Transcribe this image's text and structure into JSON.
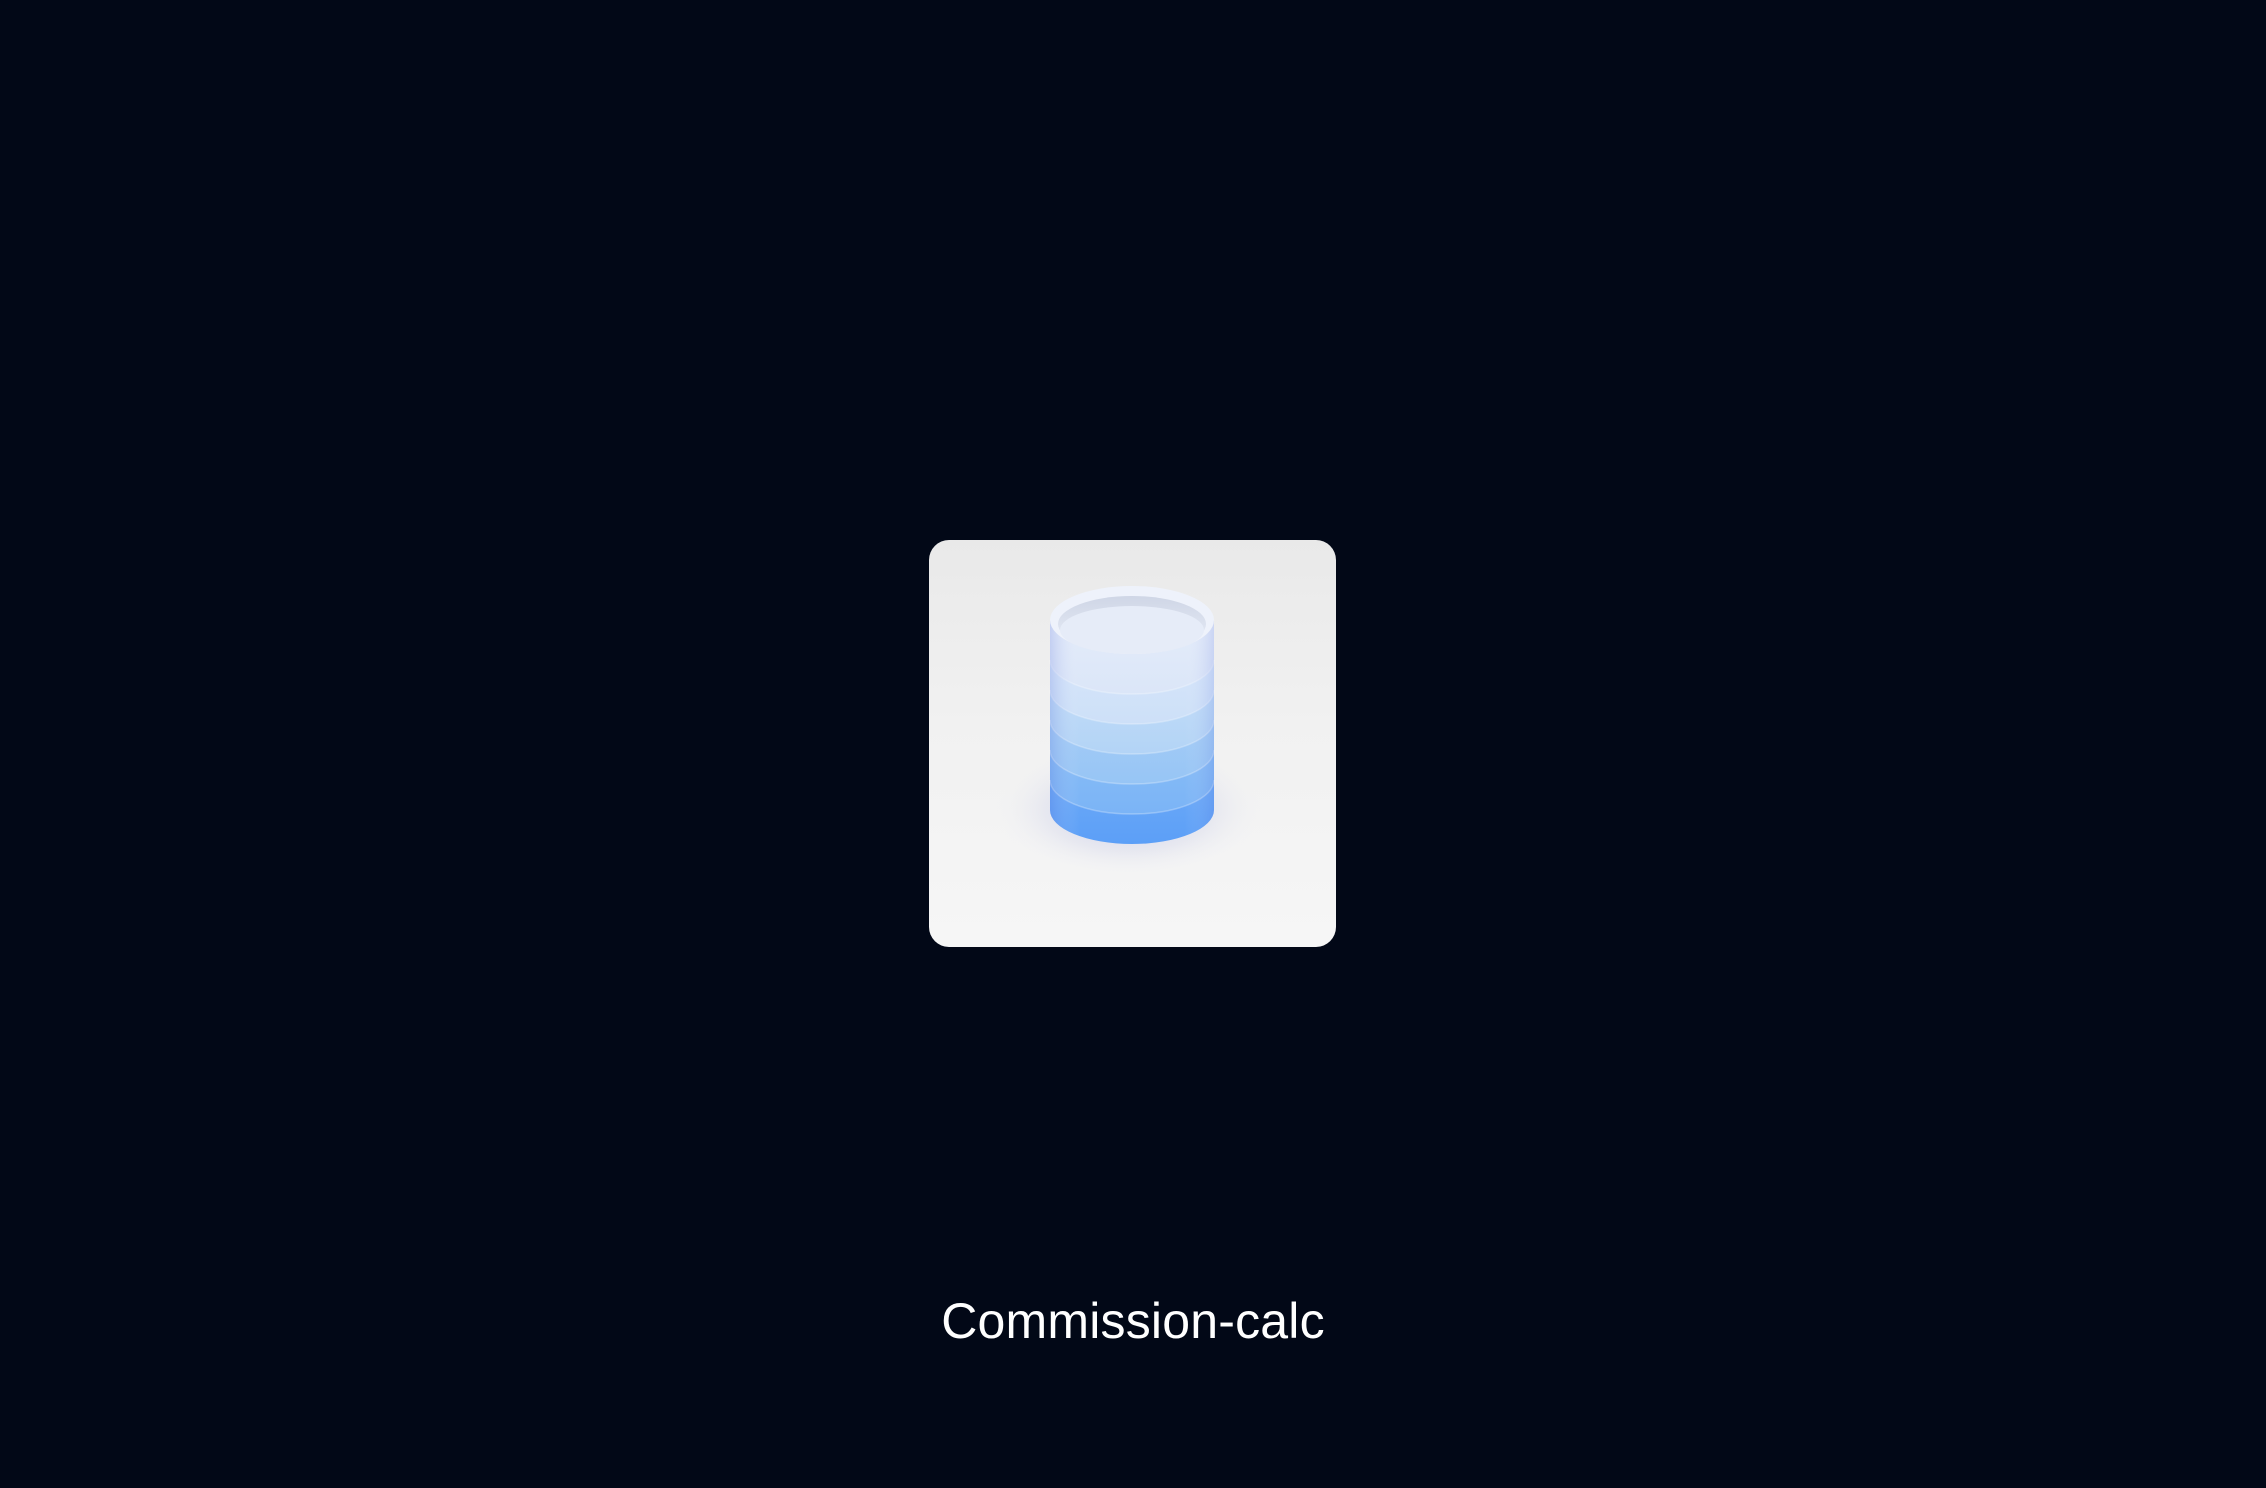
{
  "app": {
    "name": "Commission-calc",
    "icon": "database-cylinder-icon"
  },
  "colors": {
    "background": "#020817",
    "tile": "#f2f2f2",
    "accent_top": "#e2ebf9",
    "accent_bottom": "#5fa4f7",
    "label": "#ffffff"
  }
}
